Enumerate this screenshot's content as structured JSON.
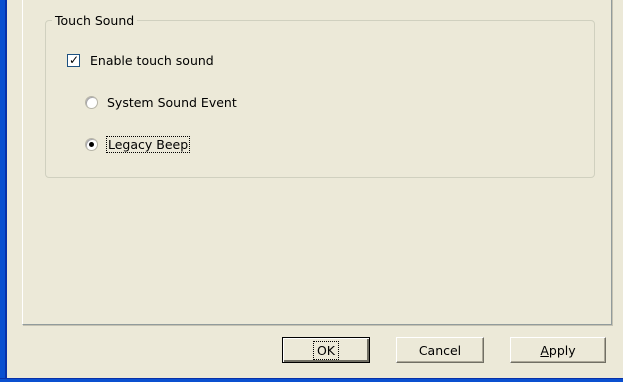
{
  "group": {
    "title": "Touch Sound"
  },
  "enable_touch_sound": {
    "label": "Enable touch sound",
    "checked": true
  },
  "radios": [
    {
      "label": "System Sound Event",
      "selected": false
    },
    {
      "label": "Legacy Beep",
      "selected": true
    }
  ],
  "buttons": {
    "ok": "OK",
    "cancel": "Cancel",
    "apply": "Apply"
  },
  "colors": {
    "window_frame": "#0a50d0",
    "dialog_background": "#ece9d8"
  }
}
